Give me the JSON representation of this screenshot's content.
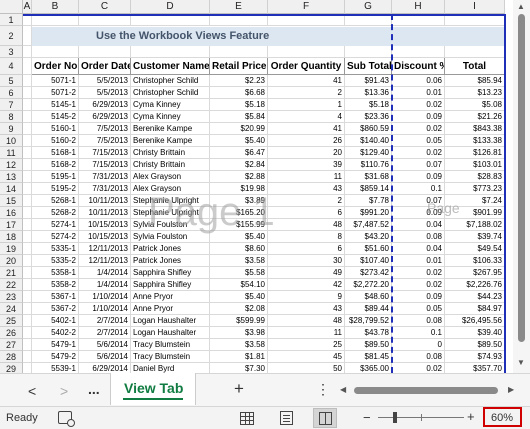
{
  "sheet": {
    "columns": [
      "A",
      "B",
      "C",
      "D",
      "E",
      "F",
      "G",
      "H",
      "I"
    ],
    "row_numbers": [
      "1",
      "2",
      "3",
      "4",
      "5",
      "6",
      "7",
      "8",
      "9",
      "10",
      "11",
      "12",
      "13",
      "14",
      "15",
      "16",
      "17",
      "18",
      "19",
      "20",
      "21",
      "22",
      "23",
      "24",
      "25",
      "26",
      "27",
      "28",
      "29"
    ],
    "title": "Use the Workbook Views Feature",
    "headers": [
      "Order No",
      "Order Date",
      "Customer Name",
      "Retail Price",
      "Order Quantity",
      "Sub Total",
      "Discount %",
      "Total"
    ],
    "rows": [
      [
        "5071-1",
        "5/5/2013",
        "Christopher Schild",
        "$2.23",
        "41",
        "$91.43",
        "0.06",
        "$85.94"
      ],
      [
        "5071-2",
        "5/5/2013",
        "Christopher Schild",
        "$6.68",
        "2",
        "$13.36",
        "0.01",
        "$13.23"
      ],
      [
        "5145-1",
        "6/29/2013",
        "Cyma Kinney",
        "$5.18",
        "1",
        "$5.18",
        "0.02",
        "$5.08"
      ],
      [
        "5145-2",
        "6/29/2013",
        "Cyma Kinney",
        "$5.84",
        "4",
        "$23.36",
        "0.09",
        "$21.26"
      ],
      [
        "5160-1",
        "7/5/2013",
        "Berenike Kampe",
        "$20.99",
        "41",
        "$860.59",
        "0.02",
        "$843.38"
      ],
      [
        "5160-2",
        "7/5/2013",
        "Berenike Kampe",
        "$5.40",
        "26",
        "$140.40",
        "0.05",
        "$133.38"
      ],
      [
        "5168-1",
        "7/15/2013",
        "Christy Brittain",
        "$6.47",
        "20",
        "$129.40",
        "0.02",
        "$126.81"
      ],
      [
        "5168-2",
        "7/15/2013",
        "Christy Brittain",
        "$2.84",
        "39",
        "$110.76",
        "0.07",
        "$103.01"
      ],
      [
        "5195-1",
        "7/31/2013",
        "Alex Grayson",
        "$2.88",
        "11",
        "$31.68",
        "0.09",
        "$28.83"
      ],
      [
        "5195-2",
        "7/31/2013",
        "Alex Grayson",
        "$19.98",
        "43",
        "$859.14",
        "0.1",
        "$773.23"
      ],
      [
        "5268-1",
        "10/11/2013",
        "Stephanie Ulpright",
        "$3.89",
        "2",
        "$7.78",
        "0.07",
        "$7.24"
      ],
      [
        "5268-2",
        "10/11/2013",
        "Stephanie Ulpright",
        "$165.20",
        "6",
        "$991.20",
        "0.09",
        "$901.99"
      ],
      [
        "5274-1",
        "10/15/2013",
        "Sylvia Foulston",
        "$155.99",
        "48",
        "$7,487.52",
        "0.04",
        "$7,188.02"
      ],
      [
        "5274-2",
        "10/15/2013",
        "Sylvia Foulston",
        "$5.40",
        "8",
        "$43.20",
        "0.08",
        "$39.74"
      ],
      [
        "5335-1",
        "12/11/2013",
        "Patrick Jones",
        "$8.60",
        "6",
        "$51.60",
        "0.04",
        "$49.54"
      ],
      [
        "5335-2",
        "12/11/2013",
        "Patrick Jones",
        "$3.58",
        "30",
        "$107.40",
        "0.01",
        "$106.33"
      ],
      [
        "5358-1",
        "1/4/2014",
        "Sapphira Shifley",
        "$5.58",
        "49",
        "$273.42",
        "0.02",
        "$267.95"
      ],
      [
        "5358-2",
        "1/4/2014",
        "Sapphira Shifley",
        "$54.10",
        "42",
        "$2,272.20",
        "0.02",
        "$2,226.76"
      ],
      [
        "5367-1",
        "1/10/2014",
        "Anne Pryor",
        "$5.40",
        "9",
        "$48.60",
        "0.09",
        "$44.23"
      ],
      [
        "5367-2",
        "1/10/2014",
        "Anne Pryor",
        "$2.08",
        "43",
        "$89.44",
        "0.05",
        "$84.97"
      ],
      [
        "5402-1",
        "2/7/2014",
        "Logan Haushalter",
        "$599.99",
        "48",
        "$28,799.52",
        "0.08",
        "$26,495.56"
      ],
      [
        "5402-2",
        "2/7/2014",
        "Logan Haushalter",
        "$3.98",
        "11",
        "$43.78",
        "0.1",
        "$39.40"
      ],
      [
        "5479-1",
        "5/6/2014",
        "Tracy Blumstein",
        "$3.58",
        "25",
        "$89.50",
        "0",
        "$89.50"
      ],
      [
        "5479-2",
        "5/6/2014",
        "Tracy Blumstein",
        "$1.81",
        "45",
        "$81.45",
        "0.08",
        "$74.93"
      ],
      [
        "5539-1",
        "6/29/2014",
        "Daniel Byrd",
        "$7.30",
        "50",
        "$365.00",
        "0.02",
        "$357.70"
      ]
    ],
    "watermark": "Page 1",
    "watermark_small": "Page"
  },
  "tabs": {
    "active_sheet": "View Tab",
    "prev_label": "<",
    "next_label": ">",
    "more_label": "...",
    "add_label": "+",
    "options_label": "⋮"
  },
  "status": {
    "ready": "Ready",
    "zoom": "60%",
    "zoom_minus": "−",
    "zoom_plus": "+"
  }
}
